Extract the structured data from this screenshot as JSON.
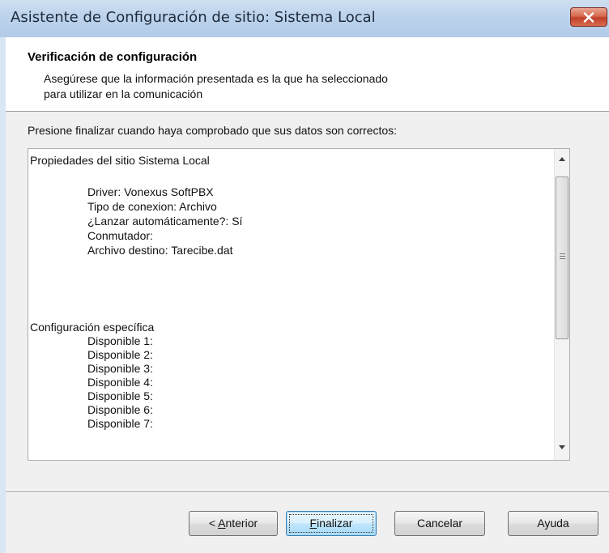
{
  "window": {
    "title": "Asistente de Configuración de sitio: Sistema Local"
  },
  "header": {
    "title": "Verificación de configuración",
    "subtitle_line1": "Asegúrese que la información presentada es la que ha seleccionado",
    "subtitle_line2": "para utilizar en la comunicación"
  },
  "instruction": "Presione finalizar cuando haya comprobado que sus datos son correctos:",
  "details": {
    "heading": "Propiedades del sitio Sistema Local",
    "properties": [
      "Driver: Vonexus SoftPBX",
      "Tipo de conexion: Archivo",
      "¿Lanzar automáticamente?: Sí",
      "Conmutador:",
      "Archivo destino: Tarecibe.dat"
    ],
    "specific_heading": "Configuración específica",
    "specific_items": [
      "Disponible 1:",
      "Disponible 2:",
      "Disponible 3:",
      "Disponible 4:",
      "Disponible 5:",
      "Disponible 6:",
      "Disponible 7:"
    ]
  },
  "buttons": {
    "back": {
      "prefix": "< ",
      "mnemonic": "A",
      "rest": "nterior"
    },
    "finish": {
      "mnemonic": "F",
      "rest": "inalizar"
    },
    "cancel": "Cancelar",
    "help": "Ayuda"
  },
  "icons": {
    "close": "close-icon",
    "scroll_up": "arrow-up-icon",
    "scroll_down": "arrow-down-icon",
    "grip": "grip-icon"
  },
  "colors": {
    "title_bar": "#bcd3ec",
    "close_button": "#c0402a",
    "dialog_background": "#f0f0f0",
    "default_button_border": "#3c7fb1"
  }
}
